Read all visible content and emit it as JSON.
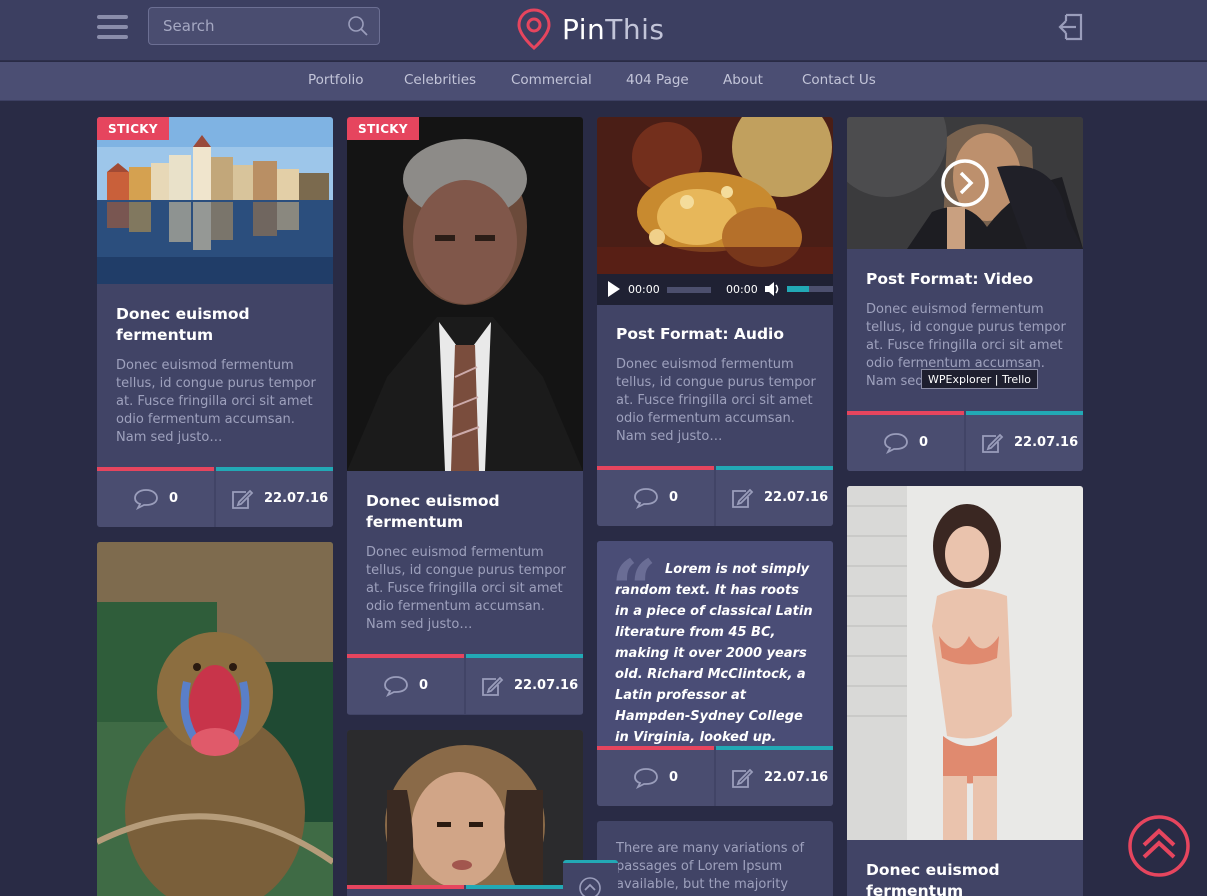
{
  "header": {
    "search_placeholder": "Search",
    "logo_part1": "Pin",
    "logo_part2": "This"
  },
  "nav": [
    "Portfolio",
    "Celebrities",
    "Commercial",
    "404 Page",
    "About",
    "Contact Us"
  ],
  "colors": {
    "accent_red": "#e6455e",
    "accent_teal": "#22a9b5",
    "card_bg": "#414466",
    "page_bg": "#292b45"
  },
  "cards": {
    "c1": {
      "badge": "STICKY",
      "title": "Donec euismod fermentum",
      "excerpt": "Donec euismod fermentum tellus, id congue purus tempor at. Fusce fringilla orci sit amet odio fermentum accumsan. Nam sed justo…",
      "comments": "0",
      "date": "22.07.16"
    },
    "c2": {
      "badge": "STICKY",
      "title": "Donec euismod fermentum",
      "excerpt": "Donec euismod fermentum tellus, id congue purus tempor at. Fusce fringilla orci sit amet odio fermentum accumsan. Nam sed justo…",
      "comments": "0",
      "date": "22.07.16"
    },
    "c3": {
      "title": "Post Format: Audio",
      "excerpt": "Donec euismod fermentum tellus, id congue purus tempor at. Fusce fringilla orci sit amet odio fermentum accumsan. Nam sed justo…",
      "comments": "0",
      "date": "22.07.16",
      "time_current": "00:00",
      "time_total": "00:00"
    },
    "c4": {
      "title": "Post Format: Video",
      "excerpt": "Donec euismod fermentum tellus, id congue purus tempor at. Fusce fringilla orci sit amet odio fermentum accumsan. Nam sed",
      "comments": "0",
      "date": "22.07.16"
    },
    "quote": {
      "text": "Lorem is not simply random text. It has roots in a piece of classical Latin literature from 45 BC, making it over 2000 years old. Richard McClintock, a Latin professor at Hampden-Sydney College in Virginia, looked up.",
      "comments": "0",
      "date": "22.07.16"
    },
    "text_card": {
      "excerpt": "There are many variations of passages of Lorem Ipsum available, but the majority"
    },
    "c_last": {
      "title": "Donec euismod fermentum"
    }
  },
  "tooltip": "WPExplorer | Trello"
}
